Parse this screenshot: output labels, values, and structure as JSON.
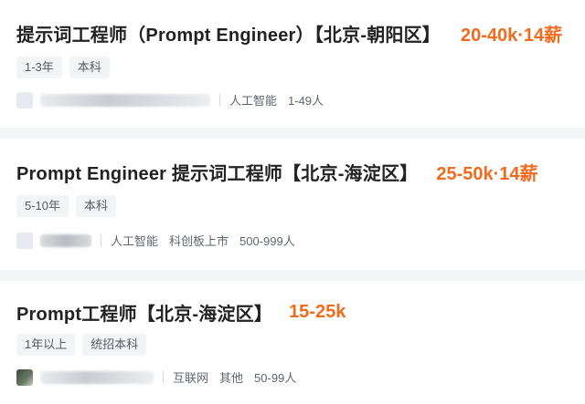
{
  "jobs": [
    {
      "title": "提示词工程师（Prompt Engineer）【北京-朝阳区】",
      "salary": "20-40k·14薪",
      "tags": [
        "1-3年",
        "本科"
      ],
      "company": {
        "name_redacted": true,
        "meta": [
          "人工智能",
          "1-49人"
        ]
      }
    },
    {
      "title": "Prompt Engineer 提示词工程师【北京-海淀区】",
      "salary": "25-50k·14薪",
      "tags": [
        "5-10年",
        "本科"
      ],
      "company": {
        "name_redacted": true,
        "meta": [
          "人工智能",
          "科创板上市",
          "500-999人"
        ]
      }
    },
    {
      "title": "Prompt工程师【北京-海淀区】",
      "salary": "15-25k",
      "tags": [
        "1年以上",
        "统招本科"
      ],
      "company": {
        "name_redacted": true,
        "meta": [
          "互联网",
          "其他",
          "50-99人"
        ]
      }
    }
  ],
  "colors": {
    "salary": "#f26b1d",
    "title": "#222222",
    "tag_bg": "#f3f4f6",
    "page_bg": "#f4f5f7"
  }
}
